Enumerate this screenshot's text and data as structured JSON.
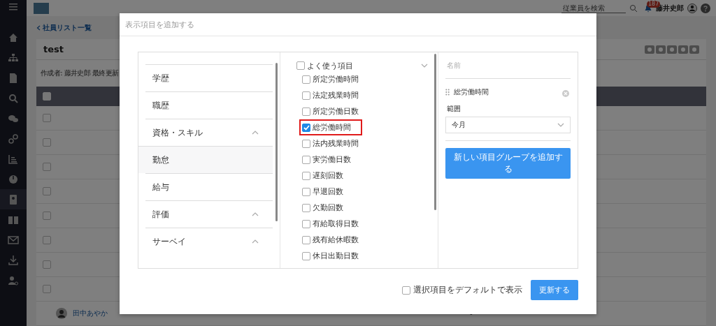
{
  "topbar": {
    "search": {
      "placeholder": "従業員を検索"
    },
    "notification_count": "187",
    "user_name": "藤井史郎"
  },
  "back_link": "社員リスト一覧",
  "card": {
    "title": "test",
    "meta": "作成者: 藤井史郎 最終更新"
  },
  "table": {
    "header_checked": false,
    "rows": [
      {
        "checked": false
      },
      {
        "checked": false
      },
      {
        "checked": false
      },
      {
        "checked": false
      },
      {
        "checked": false
      },
      {
        "checked": false
      },
      {
        "checked": false
      },
      {
        "checked": false
      }
    ],
    "last_row": {
      "name": "田中あやか",
      "value": "-"
    }
  },
  "modal": {
    "title": "表示項目を追加する",
    "categories": [
      {
        "label": "学歴",
        "collapsible": false,
        "selected": false
      },
      {
        "label": "職歴",
        "collapsible": false,
        "selected": false
      },
      {
        "label": "資格・スキル",
        "collapsible": true,
        "selected": false
      },
      {
        "label": "勤怠",
        "collapsible": false,
        "selected": true
      },
      {
        "label": "給与",
        "collapsible": false,
        "selected": false
      },
      {
        "label": "評価",
        "collapsible": true,
        "selected": false
      },
      {
        "label": "サーベイ",
        "collapsible": true,
        "selected": false
      }
    ],
    "group": {
      "label": "よく使う項目",
      "checked": false
    },
    "fields": [
      {
        "label": "所定労働時間",
        "checked": false,
        "highlighted": false
      },
      {
        "label": "法定残業時間",
        "checked": false,
        "highlighted": false
      },
      {
        "label": "所定労働日数",
        "checked": false,
        "highlighted": false
      },
      {
        "label": "総労働時間",
        "checked": true,
        "highlighted": true
      },
      {
        "label": "法内残業時間",
        "checked": false,
        "highlighted": false
      },
      {
        "label": "実労働日数",
        "checked": false,
        "highlighted": false
      },
      {
        "label": "遅刻回数",
        "checked": false,
        "highlighted": false
      },
      {
        "label": "早退回数",
        "checked": false,
        "highlighted": false
      },
      {
        "label": "欠勤回数",
        "checked": false,
        "highlighted": false
      },
      {
        "label": "有給取得日数",
        "checked": false,
        "highlighted": false
      },
      {
        "label": "残有給休暇数",
        "checked": false,
        "highlighted": false
      },
      {
        "label": "休日出勤日数",
        "checked": false,
        "highlighted": false
      }
    ],
    "name_placeholder": "名前",
    "selected_items": [
      {
        "label": "総労働時間",
        "range_label": "範囲",
        "range_value": "今月"
      }
    ],
    "add_group_button": "新しい項目グループを追加する",
    "default_checkbox": {
      "label": "選択項目をデフォルトで表示",
      "checked": false
    },
    "submit_button": "更新する"
  }
}
